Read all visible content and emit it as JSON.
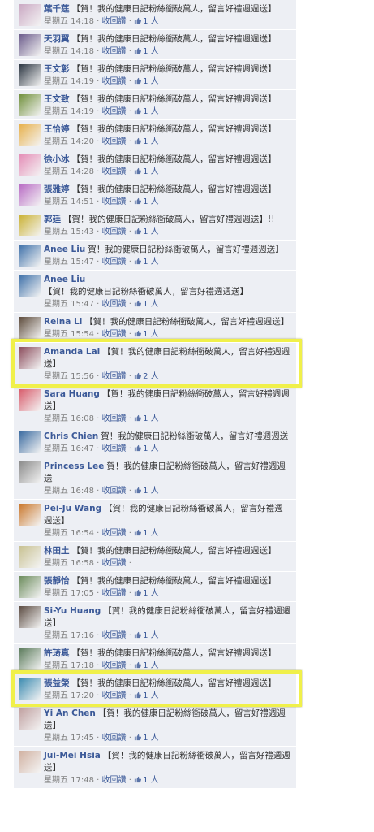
{
  "ui": {
    "reply_label": "收回",
    "reply_suffix": "讚",
    "like_unit": "人"
  },
  "comments": [
    {
      "name": "葉千莛",
      "text": "【賀！我的健康日記粉絲衝破萬人，留言好禮週週送】",
      "time": "星期五 14:18",
      "likes": "1",
      "avatar": "#c9a7c2"
    },
    {
      "name": "天羽翼",
      "text": "【賀！我的健康日記粉絲衝破萬人，留言好禮週週送】",
      "time": "星期五 14:18",
      "likes": "1",
      "avatar": "#6a5a8a"
    },
    {
      "name": "王文彰",
      "text": "【賀！我的健康日記粉絲衝破萬人，留言好禮週週送】",
      "time": "星期五 14:19",
      "likes": "1",
      "avatar": "#2a3440"
    },
    {
      "name": "王文致",
      "text": "【賀！我的健康日記粉絲衝破萬人，留言好禮週週送】",
      "time": "星期五 14:19",
      "likes": "1",
      "avatar": "#6f8f3a"
    },
    {
      "name": "王怡婷",
      "text": "【賀！我的健康日記粉絲衝破萬人，留言好禮週週送】",
      "time": "星期五 14:20",
      "likes": "1",
      "avatar": "#e7b04a"
    },
    {
      "name": "徐小冰",
      "text": "【賀！我的健康日記粉絲衝破萬人，留言好禮週週送】",
      "time": "星期五 14:28",
      "likes": "1",
      "avatar": "#e48cb6"
    },
    {
      "name": "張雅婷",
      "text": "【賀！我的健康日記粉絲衝破萬人，留言好禮週週送】",
      "time": "星期五 14:51",
      "likes": "1",
      "avatar": "#b86bc4"
    },
    {
      "name": "郭廷",
      "text": "【賀！我的健康日記粉絲衝破萬人，留言好禮週週送】!!",
      "time": "星期五 15:43",
      "likes": "1",
      "avatar": "#c9b030"
    },
    {
      "name": "Anee Liu",
      "text": "賀！我的健康日記粉絲衝破萬人，留言好禮週週送】",
      "time": "星期五 15:47",
      "likes": "1",
      "avatar": "#3b6ea8"
    },
    {
      "name": "Anee Liu",
      "text": "【賀！我的健康日記粉絲衝破萬人，留言好禮週週送】",
      "time": "星期五 15:47",
      "likes": "1",
      "avatar": "#3b6ea8"
    },
    {
      "name": "Reina Li",
      "text": "【賀！我的健康日記粉絲衝破萬人，留言好禮週週送】",
      "time": "星期五 15:54",
      "likes": "1",
      "avatar": "#5c4a3a"
    },
    {
      "name": "Amanda Lai",
      "text": "【賀！我的健康日記粉絲衝破萬人，留言好禮週週送】",
      "time": "星期五 15:56",
      "likes": "2",
      "avatar": "#8a4a5a"
    },
    {
      "name": "Sara Huang",
      "text": "【賀！我的健康日記粉絲衝破萬人，留言好禮週週送】",
      "time": "星期五 16:08",
      "likes": "1",
      "avatar": "#d85a6a"
    },
    {
      "name": "Chris Chien",
      "text": "賀！我的健康日記粉絲衝破萬人，留言好禮週週送",
      "time": "星期五 16:47",
      "likes": "1",
      "avatar": "#3a6aa0"
    },
    {
      "name": "Princess Lee",
      "text": "賀！我的健康日記粉絲衝破萬人，留言好禮週週送",
      "time": "星期五 16:48",
      "likes": "1",
      "avatar": "#8a8a8a"
    },
    {
      "name": "Pei-Ju Wang",
      "text": "【賀！我的健康日記粉絲衝破萬人，留言好禮週週送】",
      "time": "星期五 16:54",
      "likes": "1",
      "avatar": "#c9762a"
    },
    {
      "name": "林田土",
      "text": "【賀！我的健康日記粉絲衝破萬人，留言好禮週週送】",
      "time": "星期五 16:58",
      "likes": "",
      "avatar": "#c7c090"
    },
    {
      "name": "張靜怡",
      "text": "【賀！我的健康日記粉絲衝破萬人，留言好禮週週送】",
      "time": "星期五 17:05",
      "likes": "1",
      "avatar": "#6a8a5a"
    },
    {
      "name": "Si-Yu Huang",
      "text": "【賀！我的健康日記粉絲衝破萬人，留言好禮週週送】",
      "time": "星期五 17:16",
      "likes": "1",
      "avatar": "#5a4a40"
    },
    {
      "name": "許琦真",
      "text": "【賀！我的健康日記粉絲衝破萬人，留言好禮週週送】",
      "time": "星期五 17:18",
      "likes": "1",
      "avatar": "#5a7a5a"
    },
    {
      "name": "張益榮",
      "text": "【賀！我的健康日記粉絲衝破萬人，留言好禮週週送】",
      "time": "星期五 17:20",
      "likes": "1",
      "avatar": "#3a8ab0"
    },
    {
      "name": "Yi An Chen",
      "text": "【賀！我的健康日記粉絲衝破萬人，留言好禮週週送】",
      "time": "星期五 17:45",
      "likes": "1",
      "avatar": "#c0a0a0"
    },
    {
      "name": "Jui-Mei Hsia",
      "text": "【賀！我的健康日記粉絲衝破萬人，留言好禮週週送】",
      "time": "星期五 17:48",
      "likes": "1",
      "avatar": "#d0b0a0"
    }
  ],
  "highlights": [
    11,
    20
  ],
  "colors": {
    "highlight": "#f0f04a",
    "link": "#3b5998",
    "row_bg": "#edeff4"
  }
}
